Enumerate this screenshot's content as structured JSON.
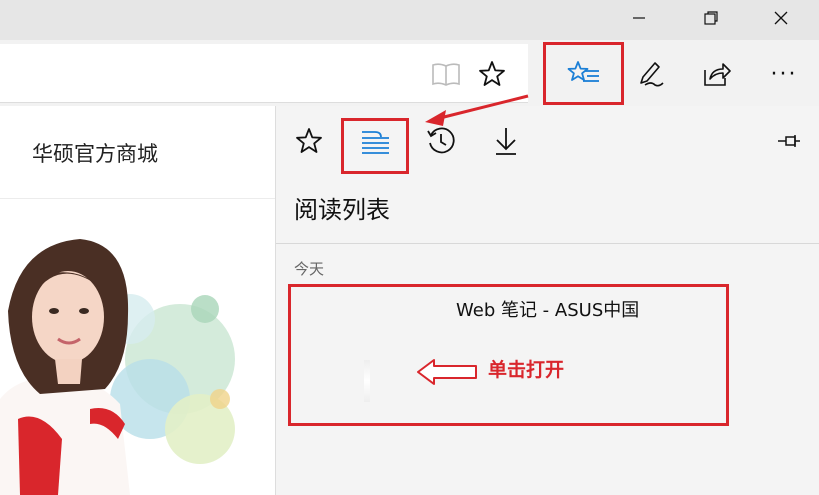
{
  "colors": {
    "accent": "#1b7fd6",
    "annotation_red": "#d9262c",
    "titlebar": "#e6e6e6",
    "panel_bg": "#f4f4f4"
  },
  "window_controls": {
    "minimize_icon": "minimize-icon",
    "restore_icon": "restore-icon",
    "close_icon": "close-icon"
  },
  "toolbar": {
    "reading_view_icon": "book-icon",
    "favorite_icon": "star-icon",
    "hub_icon": "hub-star-list-icon",
    "notes_icon": "pen-icon",
    "share_icon": "share-icon",
    "more_label": "···"
  },
  "page": {
    "site_title": "华硕官方商城"
  },
  "hub": {
    "tabs": [
      {
        "name": "favorites",
        "icon": "star-icon"
      },
      {
        "name": "reading-list",
        "icon": "reading-list-icon",
        "active": true
      },
      {
        "name": "history",
        "icon": "history-icon"
      },
      {
        "name": "downloads",
        "icon": "download-icon"
      }
    ],
    "pin_icon": "pin-icon",
    "title": "阅读列表",
    "section_label": "今天",
    "items": [
      {
        "title": "Web 笔记 - ASUS中国"
      }
    ]
  },
  "annotation": {
    "text": "单击打开"
  }
}
